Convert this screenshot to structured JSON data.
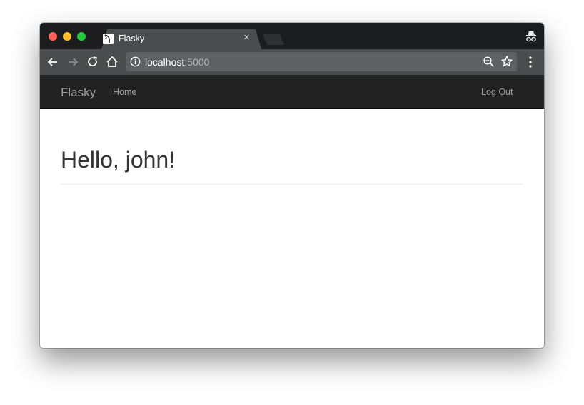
{
  "browser": {
    "tab": {
      "title": "Flasky",
      "close_glyph": "×"
    },
    "address_bar": {
      "host": "localhost",
      "port": ":5000"
    },
    "icons": [
      "back-icon",
      "forward-icon",
      "reload-icon",
      "home-icon",
      "info-icon",
      "zoom-icon",
      "star-icon",
      "menu-icon",
      "incognito-icon"
    ]
  },
  "navbar": {
    "brand": "Flasky",
    "items": [
      {
        "label": "Home"
      }
    ],
    "right_items": [
      {
        "label": "Log Out"
      }
    ]
  },
  "main": {
    "heading": "Hello, john!"
  },
  "colors": {
    "navbar_bg": "#222222",
    "navbar_text": "#9d9d9d",
    "heading_text": "#333333",
    "tabstrip_bg": "#1b1c1e",
    "toolbar_bg": "#4b4c4e"
  }
}
